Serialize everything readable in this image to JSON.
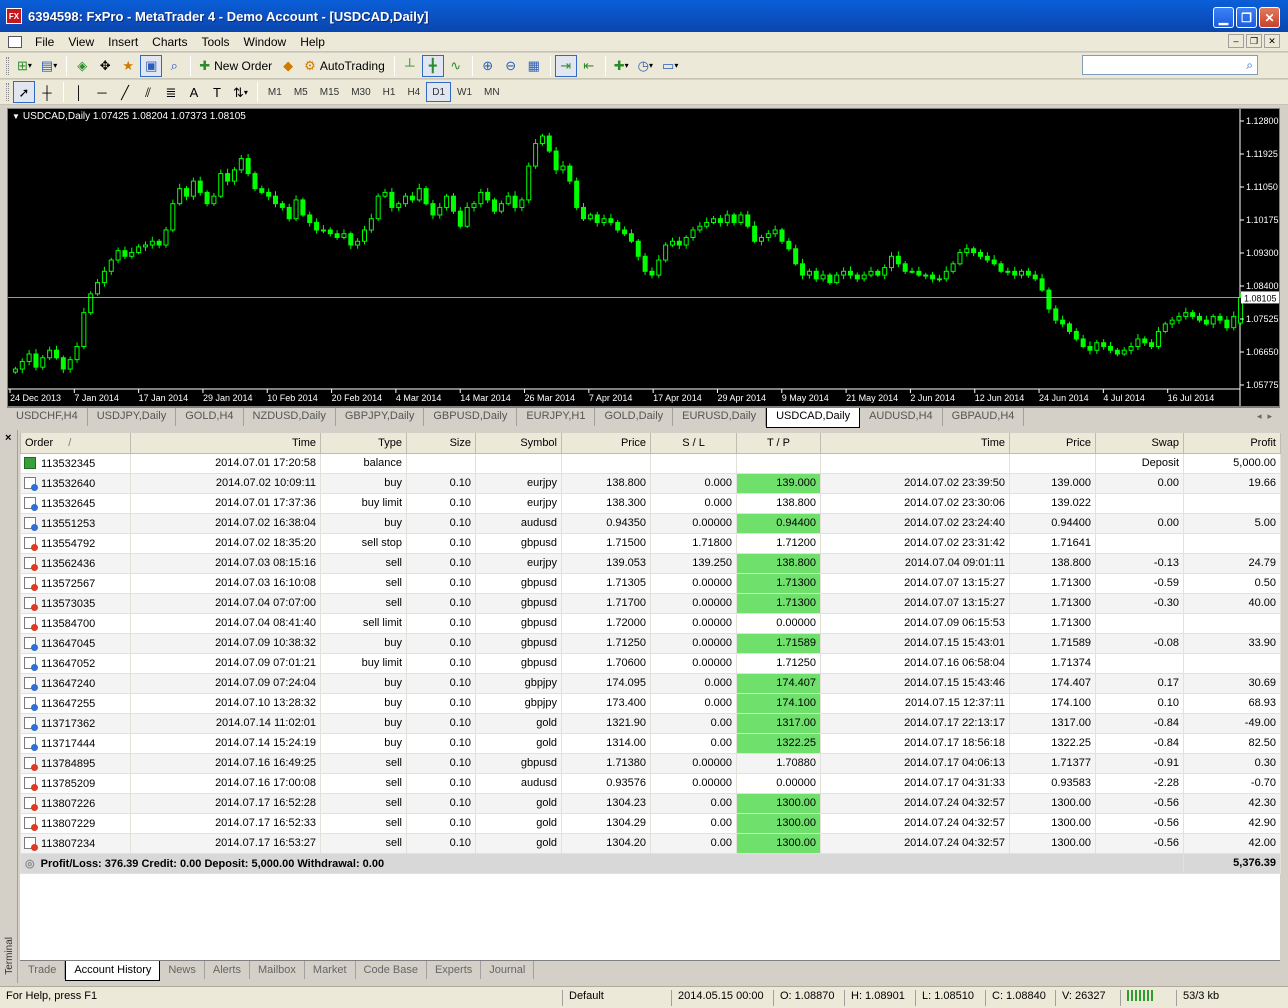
{
  "window": {
    "app_icon": "FX",
    "title": "6394598: FxPro - MetaTrader 4 - Demo Account - [USDCAD,Daily]"
  },
  "menu": [
    "File",
    "View",
    "Insert",
    "Charts",
    "Tools",
    "Window",
    "Help"
  ],
  "toolbar": {
    "new_order_label": "New Order",
    "autotrading_label": "AutoTrading",
    "search_placeholder": ""
  },
  "timeframes": [
    "M1",
    "M5",
    "M15",
    "M30",
    "H1",
    "H4",
    "D1",
    "W1",
    "MN"
  ],
  "active_timeframe": "D1",
  "chart": {
    "label": "USDCAD,Daily  1.07425 1.08204 1.07373 1.08105",
    "current_price": "1.08105",
    "bg_color": "#000000",
    "candle_color": "#00ff00",
    "price_line_color": "#c0c0c0",
    "price_axis": [
      "1.12800",
      "1.11925",
      "1.11050",
      "1.10175",
      "1.09300",
      "1.08400",
      "1.07525",
      "1.06650",
      "1.05775"
    ],
    "date_axis": [
      "24 Dec 2013",
      "7 Jan 2014",
      "17 Jan 2014",
      "29 Jan 2014",
      "10 Feb 2014",
      "20 Feb 2014",
      "4 Mar 2014",
      "14 Mar 2014",
      "26 Mar 2014",
      "7 Apr 2014",
      "17 Apr 2014",
      "29 Apr 2014",
      "9 May 2014",
      "21 May 2014",
      "2 Jun 2014",
      "12 Jun 2014",
      "24 Jun 2014",
      "4 Jul 2014",
      "16 Jul 2014"
    ]
  },
  "chart_data": {
    "type": "candlestick",
    "symbol": "USDCAD",
    "timeframe": "Daily",
    "ylim": [
      1.05775,
      1.128
    ],
    "last": {
      "open": 1.07425,
      "high": 1.08204,
      "low": 1.07373,
      "close": 1.08105
    },
    "close_series": [
      1.062,
      1.064,
      1.066,
      1.0625,
      1.065,
      1.067,
      1.065,
      1.062,
      1.0645,
      1.068,
      1.077,
      1.082,
      1.085,
      1.088,
      1.091,
      1.0935,
      1.092,
      1.093,
      1.0945,
      1.095,
      1.096,
      1.095,
      1.099,
      1.106,
      1.11,
      1.108,
      1.112,
      1.109,
      1.106,
      1.108,
      1.114,
      1.112,
      1.115,
      1.118,
      1.114,
      1.11,
      1.109,
      1.108,
      1.106,
      1.105,
      1.102,
      1.107,
      1.103,
      1.101,
      1.099,
      1.099,
      1.098,
      1.097,
      1.098,
      1.095,
      1.096,
      1.099,
      1.102,
      1.108,
      1.109,
      1.105,
      1.106,
      1.108,
      1.107,
      1.11,
      1.106,
      1.103,
      1.105,
      1.108,
      1.104,
      1.1,
      1.105,
      1.106,
      1.109,
      1.107,
      1.104,
      1.106,
      1.108,
      1.105,
      1.107,
      1.116,
      1.122,
      1.124,
      1.12,
      1.115,
      1.116,
      1.112,
      1.105,
      1.102,
      1.103,
      1.101,
      1.102,
      1.101,
      1.099,
      1.098,
      1.096,
      1.092,
      1.088,
      1.087,
      1.091,
      1.095,
      1.096,
      1.095,
      1.097,
      1.099,
      1.1,
      1.101,
      1.102,
      1.101,
      1.103,
      1.101,
      1.103,
      1.1,
      1.096,
      1.097,
      1.098,
      1.099,
      1.096,
      1.094,
      1.09,
      1.087,
      1.088,
      1.086,
      1.087,
      1.085,
      1.087,
      1.088,
      1.087,
      1.086,
      1.087,
      1.088,
      1.087,
      1.089,
      1.092,
      1.09,
      1.088,
      1.088,
      1.087,
      1.087,
      1.086,
      1.086,
      1.088,
      1.09,
      1.093,
      1.094,
      1.093,
      1.092,
      1.091,
      1.09,
      1.088,
      1.088,
      1.087,
      1.088,
      1.087,
      1.086,
      1.083,
      1.078,
      1.075,
      1.074,
      1.072,
      1.07,
      1.068,
      1.067,
      1.069,
      1.068,
      1.067,
      1.066,
      1.067,
      1.068,
      1.07,
      1.069,
      1.068,
      1.072,
      1.074,
      1.075,
      1.076,
      1.077,
      1.076,
      1.075,
      1.074,
      1.076,
      1.075,
      1.073,
      1.076,
      1.081
    ]
  },
  "chart_tabs": [
    "USDCHF,H4",
    "USDJPY,Daily",
    "GOLD,H4",
    "NZDUSD,Daily",
    "GBPJPY,Daily",
    "GBPUSD,Daily",
    "EURJPY,H1",
    "GOLD,Daily",
    "EURUSD,Daily",
    "USDCAD,Daily",
    "AUDUSD,H4",
    "GBPAUD,H4"
  ],
  "active_chart_tab": "USDCAD,Daily",
  "history": {
    "columns": [
      "Order",
      "Time",
      "Type",
      "Size",
      "Symbol",
      "Price",
      "S / L",
      "T / P",
      "Time",
      "Price",
      "Swap",
      "Profit"
    ],
    "sort_indicator": "/",
    "highlight_color": "#6ee06b",
    "rows": [
      {
        "order": "113532345",
        "open_time": "2014.07.01 17:20:58",
        "type": "balance",
        "size": "",
        "symbol": "",
        "price": "",
        "sl": "",
        "tp": "",
        "close_time": "",
        "close_price": "",
        "swap": "Deposit",
        "profit": "5,000.00",
        "icon": "bal",
        "tp_hl": false
      },
      {
        "order": "113532640",
        "open_time": "2014.07.02 10:09:11",
        "type": "buy",
        "size": "0.10",
        "symbol": "eurjpy",
        "price": "138.800",
        "sl": "0.000",
        "tp": "139.000",
        "close_time": "2014.07.02 23:39:50",
        "close_price": "139.000",
        "swap": "0.00",
        "profit": "19.66",
        "icon": "blue",
        "tp_hl": true
      },
      {
        "order": "113532645",
        "open_time": "2014.07.01 17:37:36",
        "type": "buy limit",
        "size": "0.10",
        "symbol": "eurjpy",
        "price": "138.300",
        "sl": "0.000",
        "tp": "138.800",
        "close_time": "2014.07.02 23:30:06",
        "close_price": "139.022",
        "swap": "",
        "profit": "",
        "icon": "blue",
        "tp_hl": false
      },
      {
        "order": "113551253",
        "open_time": "2014.07.02 16:38:04",
        "type": "buy",
        "size": "0.10",
        "symbol": "audusd",
        "price": "0.94350",
        "sl": "0.00000",
        "tp": "0.94400",
        "close_time": "2014.07.02 23:24:40",
        "close_price": "0.94400",
        "swap": "0.00",
        "profit": "5.00",
        "icon": "blue",
        "tp_hl": true
      },
      {
        "order": "113554792",
        "open_time": "2014.07.02 18:35:20",
        "type": "sell stop",
        "size": "0.10",
        "symbol": "gbpusd",
        "price": "1.71500",
        "sl": "1.71800",
        "tp": "1.71200",
        "close_time": "2014.07.02 23:31:42",
        "close_price": "1.71641",
        "swap": "",
        "profit": "",
        "icon": "red",
        "tp_hl": false
      },
      {
        "order": "113562436",
        "open_time": "2014.07.03 08:15:16",
        "type": "sell",
        "size": "0.10",
        "symbol": "eurjpy",
        "price": "139.053",
        "sl": "139.250",
        "tp": "138.800",
        "close_time": "2014.07.04 09:01:11",
        "close_price": "138.800",
        "swap": "-0.13",
        "profit": "24.79",
        "icon": "red",
        "tp_hl": true
      },
      {
        "order": "113572567",
        "open_time": "2014.07.03 16:10:08",
        "type": "sell",
        "size": "0.10",
        "symbol": "gbpusd",
        "price": "1.71305",
        "sl": "0.00000",
        "tp": "1.71300",
        "close_time": "2014.07.07 13:15:27",
        "close_price": "1.71300",
        "swap": "-0.59",
        "profit": "0.50",
        "icon": "red",
        "tp_hl": true
      },
      {
        "order": "113573035",
        "open_time": "2014.07.04 07:07:00",
        "type": "sell",
        "size": "0.10",
        "symbol": "gbpusd",
        "price": "1.71700",
        "sl": "0.00000",
        "tp": "1.71300",
        "close_time": "2014.07.07 13:15:27",
        "close_price": "1.71300",
        "swap": "-0.30",
        "profit": "40.00",
        "icon": "red",
        "tp_hl": true
      },
      {
        "order": "113584700",
        "open_time": "2014.07.04 08:41:40",
        "type": "sell limit",
        "size": "0.10",
        "symbol": "gbpusd",
        "price": "1.72000",
        "sl": "0.00000",
        "tp": "0.00000",
        "close_time": "2014.07.09 06:15:53",
        "close_price": "1.71300",
        "swap": "",
        "profit": "",
        "icon": "red",
        "tp_hl": false
      },
      {
        "order": "113647045",
        "open_time": "2014.07.09 10:38:32",
        "type": "buy",
        "size": "0.10",
        "symbol": "gbpusd",
        "price": "1.71250",
        "sl": "0.00000",
        "tp": "1.71589",
        "close_time": "2014.07.15 15:43:01",
        "close_price": "1.71589",
        "swap": "-0.08",
        "profit": "33.90",
        "icon": "blue",
        "tp_hl": true
      },
      {
        "order": "113647052",
        "open_time": "2014.07.09 07:01:21",
        "type": "buy limit",
        "size": "0.10",
        "symbol": "gbpusd",
        "price": "1.70600",
        "sl": "0.00000",
        "tp": "1.71250",
        "close_time": "2014.07.16 06:58:04",
        "close_price": "1.71374",
        "swap": "",
        "profit": "",
        "icon": "blue",
        "tp_hl": false
      },
      {
        "order": "113647240",
        "open_time": "2014.07.09 07:24:04",
        "type": "buy",
        "size": "0.10",
        "symbol": "gbpjpy",
        "price": "174.095",
        "sl": "0.000",
        "tp": "174.407",
        "close_time": "2014.07.15 15:43:46",
        "close_price": "174.407",
        "swap": "0.17",
        "profit": "30.69",
        "icon": "blue",
        "tp_hl": true
      },
      {
        "order": "113647255",
        "open_time": "2014.07.10 13:28:32",
        "type": "buy",
        "size": "0.10",
        "symbol": "gbpjpy",
        "price": "173.400",
        "sl": "0.000",
        "tp": "174.100",
        "close_time": "2014.07.15 12:37:11",
        "close_price": "174.100",
        "swap": "0.10",
        "profit": "68.93",
        "icon": "blue",
        "tp_hl": true
      },
      {
        "order": "113717362",
        "open_time": "2014.07.14 11:02:01",
        "type": "buy",
        "size": "0.10",
        "symbol": "gold",
        "price": "1321.90",
        "sl": "0.00",
        "tp": "1317.00",
        "close_time": "2014.07.17 22:13:17",
        "close_price": "1317.00",
        "swap": "-0.84",
        "profit": "-49.00",
        "icon": "blue",
        "tp_hl": true
      },
      {
        "order": "113717444",
        "open_time": "2014.07.14 15:24:19",
        "type": "buy",
        "size": "0.10",
        "symbol": "gold",
        "price": "1314.00",
        "sl": "0.00",
        "tp": "1322.25",
        "close_time": "2014.07.17 18:56:18",
        "close_price": "1322.25",
        "swap": "-0.84",
        "profit": "82.50",
        "icon": "blue",
        "tp_hl": true
      },
      {
        "order": "113784895",
        "open_time": "2014.07.16 16:49:25",
        "type": "sell",
        "size": "0.10",
        "symbol": "gbpusd",
        "price": "1.71380",
        "sl": "0.00000",
        "tp": "1.70880",
        "close_time": "2014.07.17 04:06:13",
        "close_price": "1.71377",
        "swap": "-0.91",
        "profit": "0.30",
        "icon": "red",
        "tp_hl": false
      },
      {
        "order": "113785209",
        "open_time": "2014.07.16 17:00:08",
        "type": "sell",
        "size": "0.10",
        "symbol": "audusd",
        "price": "0.93576",
        "sl": "0.00000",
        "tp": "0.00000",
        "close_time": "2014.07.17 04:31:33",
        "close_price": "0.93583",
        "swap": "-2.28",
        "profit": "-0.70",
        "icon": "red",
        "tp_hl": false
      },
      {
        "order": "113807226",
        "open_time": "2014.07.17 16:52:28",
        "type": "sell",
        "size": "0.10",
        "symbol": "gold",
        "price": "1304.23",
        "sl": "0.00",
        "tp": "1300.00",
        "close_time": "2014.07.24 04:32:57",
        "close_price": "1300.00",
        "swap": "-0.56",
        "profit": "42.30",
        "icon": "red",
        "tp_hl": true
      },
      {
        "order": "113807229",
        "open_time": "2014.07.17 16:52:33",
        "type": "sell",
        "size": "0.10",
        "symbol": "gold",
        "price": "1304.29",
        "sl": "0.00",
        "tp": "1300.00",
        "close_time": "2014.07.24 04:32:57",
        "close_price": "1300.00",
        "swap": "-0.56",
        "profit": "42.90",
        "icon": "red",
        "tp_hl": true
      },
      {
        "order": "113807234",
        "open_time": "2014.07.17 16:53:27",
        "type": "sell",
        "size": "0.10",
        "symbol": "gold",
        "price": "1304.20",
        "sl": "0.00",
        "tp": "1300.00",
        "close_time": "2014.07.24 04:32:57",
        "close_price": "1300.00",
        "swap": "-0.56",
        "profit": "42.00",
        "icon": "red",
        "tp_hl": true
      }
    ],
    "summary": "Profit/Loss: 376.39  Credit: 0.00  Deposit: 5,000.00  Withdrawal: 0.00",
    "summary_total": "5,376.39"
  },
  "terminal": {
    "side_label": "Terminal",
    "close_glyph": "×",
    "tabs": [
      "Trade",
      "Account History",
      "News",
      "Alerts",
      "Mailbox",
      "Market",
      "Code Base",
      "Experts",
      "Journal"
    ],
    "active_tab": "Account History"
  },
  "status": {
    "help": "For Help, press F1",
    "profile": "Default",
    "time": "2014.05.15 00:00",
    "open": "O: 1.08870",
    "high": "H: 1.08901",
    "low": "L: 1.08510",
    "close": "C: 1.08840",
    "volume": "V: 26327",
    "traffic": "53/3 kb"
  }
}
